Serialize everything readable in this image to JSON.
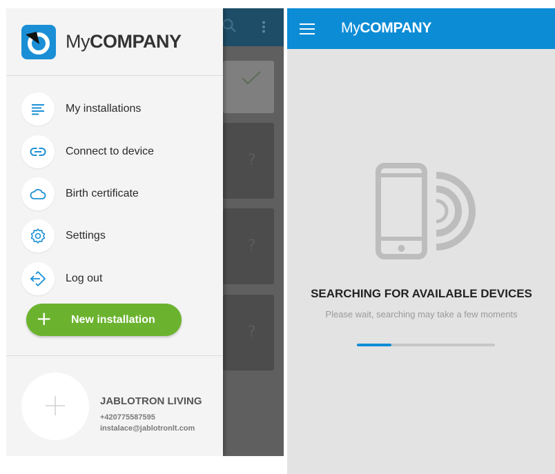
{
  "left_screen": {
    "drawer": {
      "brand": {
        "light": "My",
        "bold": "COMPANY"
      },
      "menu": [
        {
          "label": "My installations",
          "icon": "list-icon"
        },
        {
          "label": "Connect to device",
          "icon": "link-icon"
        },
        {
          "label": "Birth certificate",
          "icon": "cloud-icon"
        },
        {
          "label": "Settings",
          "icon": "gear-icon"
        },
        {
          "label": "Log out",
          "icon": "logout-icon"
        }
      ],
      "new_installation_label": "New installation",
      "profile": {
        "name": "JABLOTRON LIVING",
        "phone": "+420775587595",
        "email": "instalace@jablotronlt.com"
      }
    },
    "background_cards": [
      "?",
      "?",
      "?"
    ]
  },
  "right_screen": {
    "appbar": {
      "brand_light": "My",
      "brand_bold": "COMPANY"
    },
    "search": {
      "title": "SEARCHING FOR AVAILABLE DEVICES",
      "subtitle": "Please wait, searching may take a few moments",
      "progress": 0.25
    }
  },
  "colors": {
    "accent_blue": "#0d8cd6",
    "button_green": "#6bb32e",
    "drawer_bg": "#f4f4f4",
    "screen_bg": "#e3e3e3"
  }
}
